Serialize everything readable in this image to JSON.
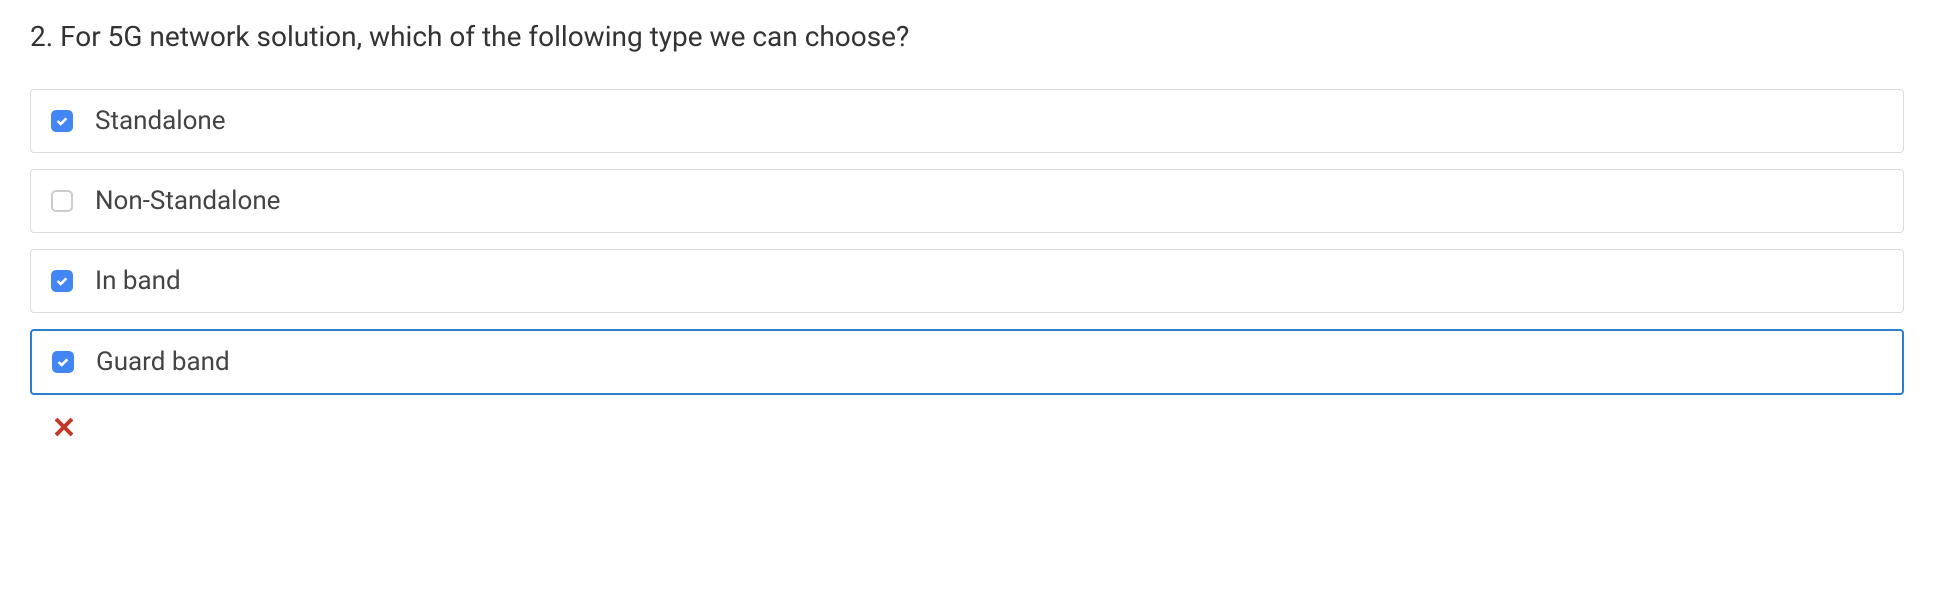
{
  "question": {
    "number": "2.",
    "text": "For 5G network solution, which of the following type we can choose?"
  },
  "options": [
    {
      "label": "Standalone",
      "checked": true,
      "highlighted": false
    },
    {
      "label": "Non-Standalone",
      "checked": false,
      "highlighted": false
    },
    {
      "label": "In band",
      "checked": true,
      "highlighted": false
    },
    {
      "label": "Guard band",
      "checked": true,
      "highlighted": true
    }
  ],
  "result": {
    "correct": false
  }
}
